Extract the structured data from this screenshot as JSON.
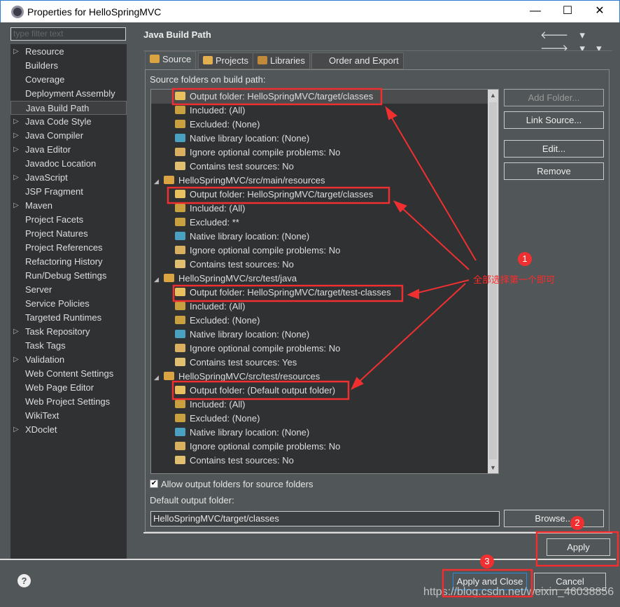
{
  "window": {
    "title": "Properties for HelloSpringMVC",
    "minimize": "—",
    "maximize": "☐",
    "close": "✕"
  },
  "sidebar": {
    "filter_placeholder": "type filter text",
    "items": [
      {
        "label": "Resource",
        "expandable": true
      },
      {
        "label": "Builders"
      },
      {
        "label": "Coverage"
      },
      {
        "label": "Deployment Assembly"
      },
      {
        "label": "Java Build Path",
        "selected": true
      },
      {
        "label": "Java Code Style",
        "expandable": true
      },
      {
        "label": "Java Compiler",
        "expandable": true
      },
      {
        "label": "Java Editor",
        "expandable": true
      },
      {
        "label": "Javadoc Location"
      },
      {
        "label": "JavaScript",
        "expandable": true
      },
      {
        "label": "JSP Fragment"
      },
      {
        "label": "Maven",
        "expandable": true
      },
      {
        "label": "Project Facets"
      },
      {
        "label": "Project Natures"
      },
      {
        "label": "Project References"
      },
      {
        "label": "Refactoring History"
      },
      {
        "label": "Run/Debug Settings"
      },
      {
        "label": "Server"
      },
      {
        "label": "Service Policies"
      },
      {
        "label": "Targeted Runtimes"
      },
      {
        "label": "Task Repository",
        "expandable": true
      },
      {
        "label": "Task Tags"
      },
      {
        "label": "Validation",
        "expandable": true
      },
      {
        "label": "Web Content Settings"
      },
      {
        "label": "Web Page Editor"
      },
      {
        "label": "Web Project Settings"
      },
      {
        "label": "WikiText"
      },
      {
        "label": "XDoclet",
        "expandable": true
      }
    ]
  },
  "header": {
    "title": "Java Build Path",
    "nav": "🡐 ▾ 🡒 ▾ ▾"
  },
  "tabs": [
    {
      "label": "Source",
      "selected": true,
      "icon": "source-folder"
    },
    {
      "label": "Projects",
      "icon": "projects"
    },
    {
      "label": "Libraries",
      "icon": "libraries"
    },
    {
      "label": "Order and Export",
      "icon": "order"
    }
  ],
  "source": {
    "label": "Source folders on build path:",
    "rows": [
      {
        "level": 1,
        "text": "Output folder: HelloSpringMVC/target/classes",
        "icon": "output-folder"
      },
      {
        "level": 1,
        "text": "Included: (All)",
        "icon": "included"
      },
      {
        "level": 1,
        "text": "Excluded: (None)",
        "icon": "excluded"
      },
      {
        "level": 1,
        "text": "Native library location: (None)",
        "icon": "native"
      },
      {
        "level": 1,
        "text": "Ignore optional compile problems: No",
        "icon": "ignore"
      },
      {
        "level": 1,
        "text": "Contains test sources: No",
        "icon": "test"
      },
      {
        "level": 0,
        "text": "HelloSpringMVC/src/main/resources",
        "icon": "package-folder"
      },
      {
        "level": 1,
        "text": "Output folder: HelloSpringMVC/target/classes",
        "icon": "output-folder"
      },
      {
        "level": 1,
        "text": "Included: (All)",
        "icon": "included"
      },
      {
        "level": 1,
        "text": "Excluded: **",
        "icon": "excluded"
      },
      {
        "level": 1,
        "text": "Native library location: (None)",
        "icon": "native"
      },
      {
        "level": 1,
        "text": "Ignore optional compile problems: No",
        "icon": "ignore"
      },
      {
        "level": 1,
        "text": "Contains test sources: No",
        "icon": "test"
      },
      {
        "level": 0,
        "text": "HelloSpringMVC/src/test/java",
        "icon": "package-folder"
      },
      {
        "level": 1,
        "text": "Output folder: HelloSpringMVC/target/test-classes",
        "icon": "output-folder"
      },
      {
        "level": 1,
        "text": "Included: (All)",
        "icon": "included"
      },
      {
        "level": 1,
        "text": "Excluded: (None)",
        "icon": "excluded"
      },
      {
        "level": 1,
        "text": "Native library location: (None)",
        "icon": "native"
      },
      {
        "level": 1,
        "text": "Ignore optional compile problems: No",
        "icon": "ignore"
      },
      {
        "level": 1,
        "text": "Contains test sources: Yes",
        "icon": "test"
      },
      {
        "level": 0,
        "text": "HelloSpringMVC/src/test/resources",
        "icon": "package-folder"
      },
      {
        "level": 1,
        "text": "Output folder: (Default output folder)",
        "icon": "output-folder"
      },
      {
        "level": 1,
        "text": "Included: (All)",
        "icon": "included"
      },
      {
        "level": 1,
        "text": "Excluded: (None)",
        "icon": "excluded"
      },
      {
        "level": 1,
        "text": "Native library location: (None)",
        "icon": "native"
      },
      {
        "level": 1,
        "text": "Ignore optional compile problems: No",
        "icon": "ignore"
      },
      {
        "level": 1,
        "text": "Contains test sources: No",
        "icon": "test"
      }
    ],
    "buttons": {
      "add_folder": "Add Folder...",
      "link_source": "Link Source...",
      "edit": "Edit...",
      "remove": "Remove"
    },
    "allow_output": {
      "label": "Allow output folders for source folders",
      "checked": true
    },
    "default_output_label": "Default output folder:",
    "default_output_value": "HelloSpringMVC/target/classes",
    "browse": "Browse..."
  },
  "footer": {
    "apply": "Apply",
    "apply_close": "Apply and Close",
    "cancel": "Cancel",
    "help": "?"
  },
  "annotations": {
    "note": "全部选择第一个即可",
    "badge1": "1",
    "badge2": "2",
    "badge3": "3",
    "color": "#f03030"
  },
  "watermark": "https://blog.csdn.net/weixin_46038856"
}
